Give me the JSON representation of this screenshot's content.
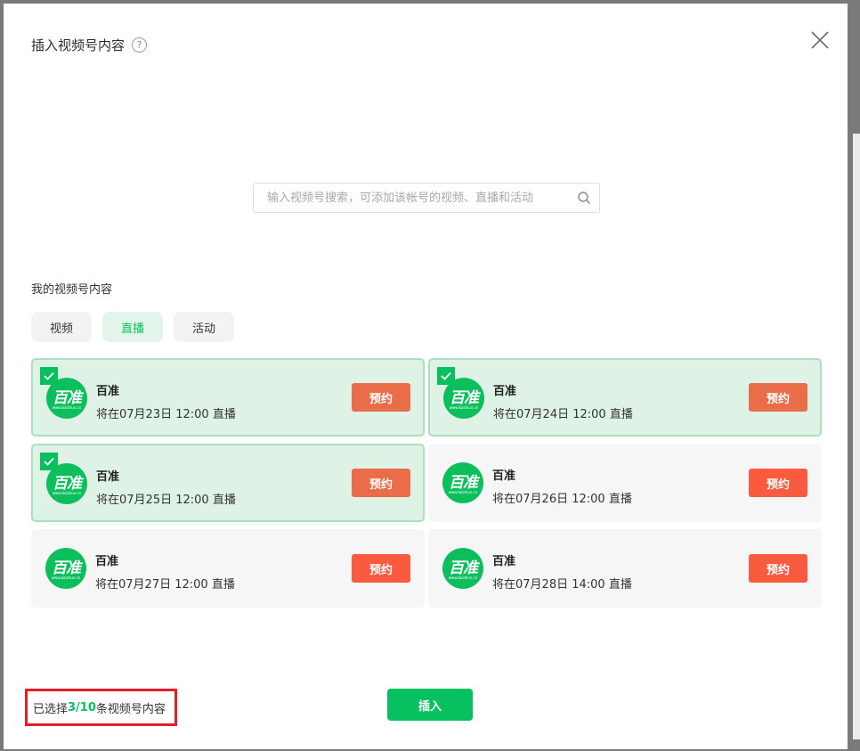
{
  "dialog": {
    "title": "插入视频号内容",
    "help_icon": "?",
    "close_icon": "close-icon"
  },
  "search": {
    "placeholder": "输入视频号搜索，可添加该帐号的视频、直播和活动"
  },
  "section_label": "我的视频号内容",
  "tabs": [
    {
      "label": "视频",
      "active": false
    },
    {
      "label": "直播",
      "active": true
    },
    {
      "label": "活动",
      "active": false
    }
  ],
  "cards": [
    {
      "name": "百准",
      "desc": "将在07月23日 12:00 直播",
      "button": "预约",
      "selected": true
    },
    {
      "name": "百准",
      "desc": "将在07月24日 12:00 直播",
      "button": "预约",
      "selected": true
    },
    {
      "name": "百准",
      "desc": "将在07月25日 12:00 直播",
      "button": "预约",
      "selected": true
    },
    {
      "name": "百准",
      "desc": "将在07月26日 12:00 直播",
      "button": "预约",
      "selected": false
    },
    {
      "name": "百准",
      "desc": "将在07月27日 12:00 直播",
      "button": "预约",
      "selected": false
    },
    {
      "name": "百准",
      "desc": "将在07月28日 14:00 直播",
      "button": "预约",
      "selected": false
    }
  ],
  "avatar": {
    "logo_text": "百准",
    "logo_sub": "www.baizhun.cn"
  },
  "footer": {
    "prefix": "已选择",
    "count": "3/10",
    "suffix": "条视频号内容",
    "insert_label": "插入"
  },
  "colors": {
    "accent": "#07c160",
    "reserve_selected": "#e86d48",
    "reserve_normal": "#fa5b3f",
    "highlight_border": "#e81c24"
  }
}
